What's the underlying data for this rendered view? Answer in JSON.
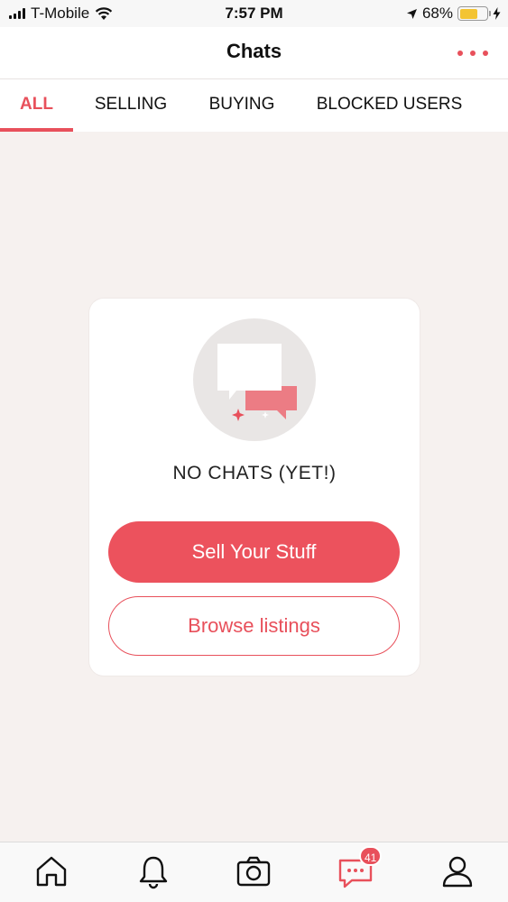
{
  "status_bar": {
    "carrier": "T-Mobile",
    "time": "7:57 PM",
    "battery_percent": "68%",
    "battery_level": 0.68,
    "icons": [
      "signal-icon",
      "wifi-icon",
      "location-arrow-icon",
      "battery-icon",
      "charging-bolt-icon"
    ]
  },
  "header": {
    "title": "Chats",
    "more_icon": "more-dots-icon"
  },
  "tabs": [
    {
      "label": "ALL",
      "active": true
    },
    {
      "label": "SELLING",
      "active": false
    },
    {
      "label": "BUYING",
      "active": false
    },
    {
      "label": "BLOCKED USERS",
      "active": false
    }
  ],
  "empty_state": {
    "illustration_icon": "chat-bubbles-icon",
    "title": "NO CHATS (YET!)",
    "primary_button": "Sell Your Stuff",
    "secondary_button": "Browse listings"
  },
  "bottom_nav": {
    "items": [
      {
        "name": "home",
        "icon": "home-icon"
      },
      {
        "name": "notifications",
        "icon": "bell-icon"
      },
      {
        "name": "camera",
        "icon": "camera-icon"
      },
      {
        "name": "chats",
        "icon": "chat-icon",
        "badge": "41"
      },
      {
        "name": "profile",
        "icon": "profile-icon"
      }
    ]
  },
  "colors": {
    "accent": "#e8505b",
    "background": "#f6f1ef",
    "card": "#ffffff"
  }
}
